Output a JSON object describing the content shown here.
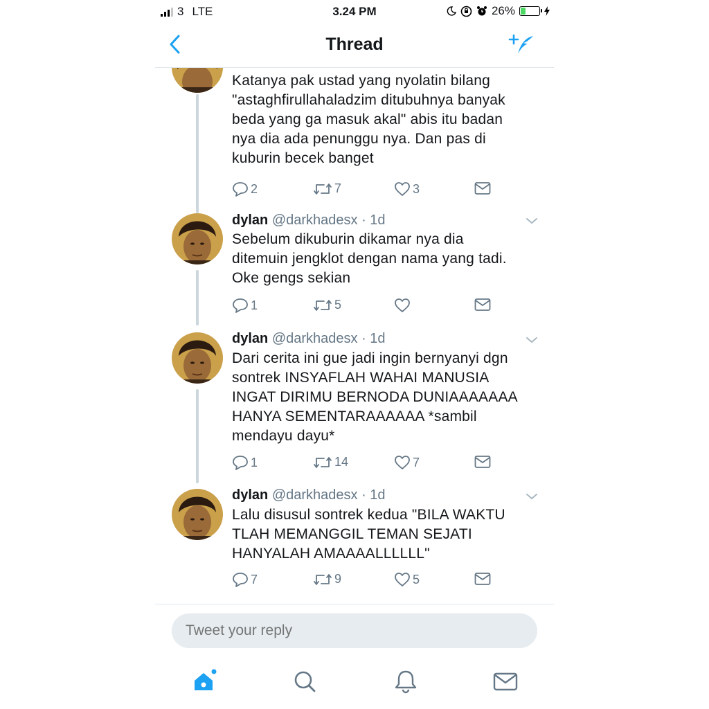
{
  "status": {
    "carrier": "3",
    "network": "LTE",
    "time": "3.24 PM",
    "battery": "26%",
    "battery_level": 0.26
  },
  "nav": {
    "title": "Thread",
    "back_icon": "chevron-left-icon",
    "compose_icon": "compose-tweet-icon"
  },
  "colors": {
    "accent": "#1da1f2",
    "muted": "#657786",
    "thread_line": "#ccd6dd"
  },
  "tweets": [
    {
      "body": "Katanya pak ustad yang nyolatin bilang\n\"astaghfirullahaladzim ditubuhnya banyak\nbeda yang ga masuk akal\" abis itu badan\nnya dia ada penunggu nya. Dan pas di\nkuburin becek banget",
      "replies": "2",
      "retweets": "7",
      "likes": "3"
    },
    {
      "name": "dylan",
      "handle": "@darkhadesx",
      "time": "· 1d",
      "body": "Sebelum dikuburin dikamar nya dia\nditemuin jengklot dengan nama yang tadi.\nOke gengs sekian",
      "replies": "1",
      "retweets": "5",
      "likes": ""
    },
    {
      "name": "dylan",
      "handle": "@darkhadesx",
      "time": "· 1d",
      "body": "Dari cerita ini gue jadi ingin bernyanyi dgn\nsontrek INSYAFLAH WAHAI MANUSIA\nINGAT DIRIMU BERNODA DUNIAAAAAAA\nHANYA SEMENTARAAAAAA *sambil\nmendayu dayu*",
      "replies": "1",
      "retweets": "14",
      "likes": "7"
    },
    {
      "name": "dylan",
      "handle": "@darkhadesx",
      "time": "· 1d",
      "body": "Lalu disusul sontrek kedua \"BILA WAKTU\nTLAH MEMANGGIL TEMAN SEJATI\nHANYALAH AMAAAALLLLLL\"",
      "replies": "7",
      "retweets": "9",
      "likes": "5"
    }
  ],
  "reply": {
    "placeholder": "Tweet your reply"
  },
  "tabs": [
    "home-icon",
    "search-icon",
    "notifications-bell-icon",
    "messages-envelope-icon"
  ]
}
